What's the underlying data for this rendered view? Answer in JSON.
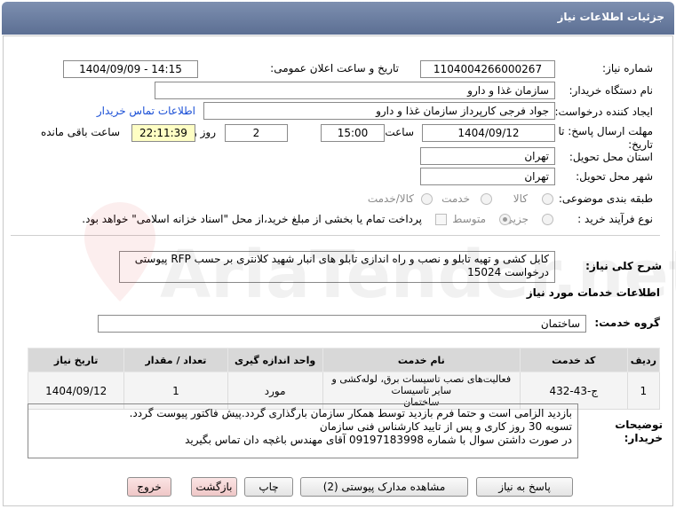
{
  "header": {
    "title": "جزئیات اطلاعات نیاز"
  },
  "fields": {
    "need_number_label": "شماره نیاز:",
    "need_number": "1104004266000267",
    "announce_label": "تاریخ و ساعت اعلان عمومی:",
    "announce_value": "1404/09/09 - 14:15",
    "buyer_org_label": "نام دستگاه خریدار:",
    "buyer_org": "سازمان غذا و دارو",
    "creator_label": "ایجاد کننده درخواست:",
    "creator": "جواد فرجی کارپرداز سازمان غذا و دارو",
    "contact_link": "اطلاعات تماس خریدار",
    "deadline_label_1": "مهلت ارسال پاسخ: تا",
    "deadline_label_2": "تاریخ:",
    "deadline_date": "1404/09/12",
    "time_label": "ساعت",
    "deadline_time": "15:00",
    "days_value": "2",
    "days_label": "روز و",
    "remaining_time": "22:11:39",
    "remaining_label": "ساعت باقی مانده",
    "province_label": "استان محل تحویل:",
    "province": "تهران",
    "city_label": "شهر محل تحویل:",
    "city": "تهران",
    "category_label": "طبقه بندی موضوعی:",
    "category_options": [
      "کالا",
      "خدمت",
      "کالا/خدمت"
    ],
    "process_label": "نوع فرآیند خرید :",
    "process_options": [
      "جزیی",
      "متوسط"
    ],
    "payment_text": "پرداخت تمام یا بخشی از مبلغ خرید،از محل \"اسناد خزانه اسلامی\" خواهد بود."
  },
  "summary": {
    "label": "شرح کلی نیاز:",
    "text": "کابل کشی و تهیه تابلو و نصب و راه اندازی تابلو های انبار شهید کلانتری بر حسب RFP پیوستی درخواست 15024"
  },
  "services": {
    "section_title": "اطلاعات خدمات مورد نیاز",
    "group_label": "گروه خدمت:",
    "group_value": "ساختمان",
    "columns": [
      "ردیف",
      "کد خدمت",
      "نام خدمت",
      "واحد اندازه گیری",
      "تعداد / مقدار",
      "تاریخ نیاز"
    ],
    "rows": [
      {
        "index": "1",
        "code": "ج-43-432",
        "name_line1": "فعالیت‌های نصب تاسیسات برق، لوله‌کشی و سایر تاسیسات",
        "name_line2": "ساختمان",
        "unit": "مورد",
        "qty": "1",
        "date": "1404/09/12"
      }
    ]
  },
  "notes": {
    "label_1": "توضیحات",
    "label_2": "خریدار:",
    "line1": "بازدید الزامی است و حتما فرم بازدید توسط همکار سازمان بارگذاری گردد.پیش فاکتور پیوست گردد.",
    "line2": "تسویه 30 روز کاری و پس از تایید کارشناس فنی سازمان",
    "line3": "در صورت داشتن سوال با شماره 09197183998 آقای مهندس باغچه دان تماس بگیرید"
  },
  "buttons": {
    "reply": "پاسخ به نیاز",
    "view_docs": "مشاهده مدارک پیوستی (2)",
    "print": "چاپ",
    "back": "بازگشت",
    "exit": "خروج"
  },
  "watermark": "AriaTender.net",
  "colors": {
    "header": "#6b7da0",
    "link": "#1a4fd6",
    "remaining_bg": "#fefec4"
  }
}
